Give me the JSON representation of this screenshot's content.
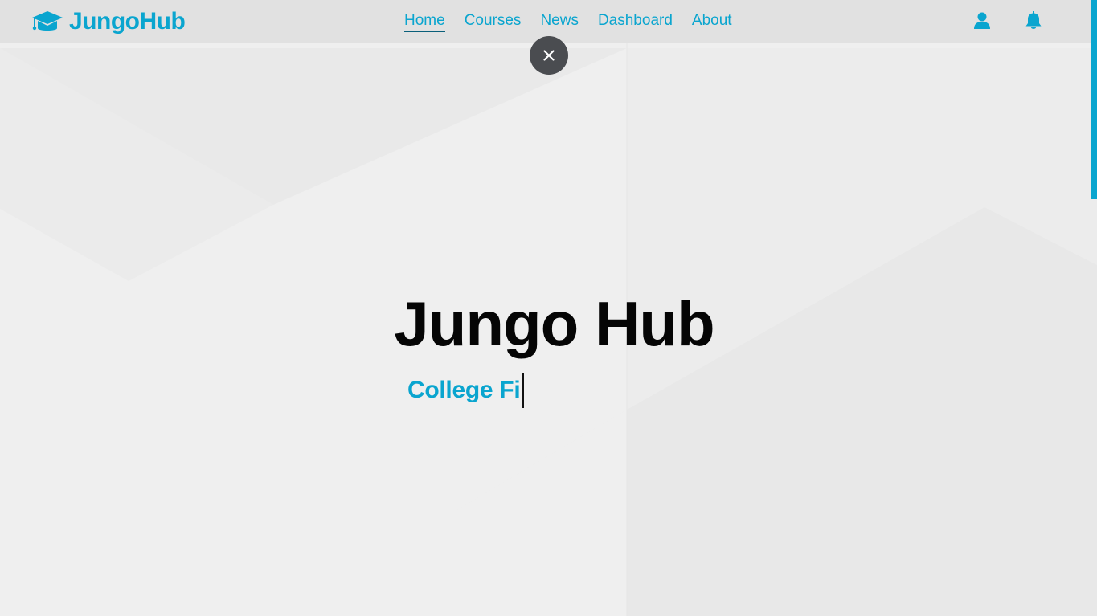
{
  "brand": {
    "name": "JungoHub",
    "icon": "graduation-cap-icon"
  },
  "nav": {
    "links": [
      {
        "label": "Home",
        "active": true
      },
      {
        "label": "Courses",
        "active": false
      },
      {
        "label": "News",
        "active": false
      },
      {
        "label": "Dashboard",
        "active": false
      },
      {
        "label": "About",
        "active": false
      }
    ],
    "user_icon": "user-icon",
    "notification_icon": "bell-icon"
  },
  "overlay": {
    "close_icon": "close-icon"
  },
  "hero": {
    "title": "Jungo Hub",
    "typed_text": "College Fi"
  },
  "colors": {
    "accent": "#0aa5cf",
    "navbar_bg": "#e1e1e1",
    "page_bg": "#efefef",
    "close_button_bg": "#4a4c50",
    "title_color": "#050505"
  }
}
